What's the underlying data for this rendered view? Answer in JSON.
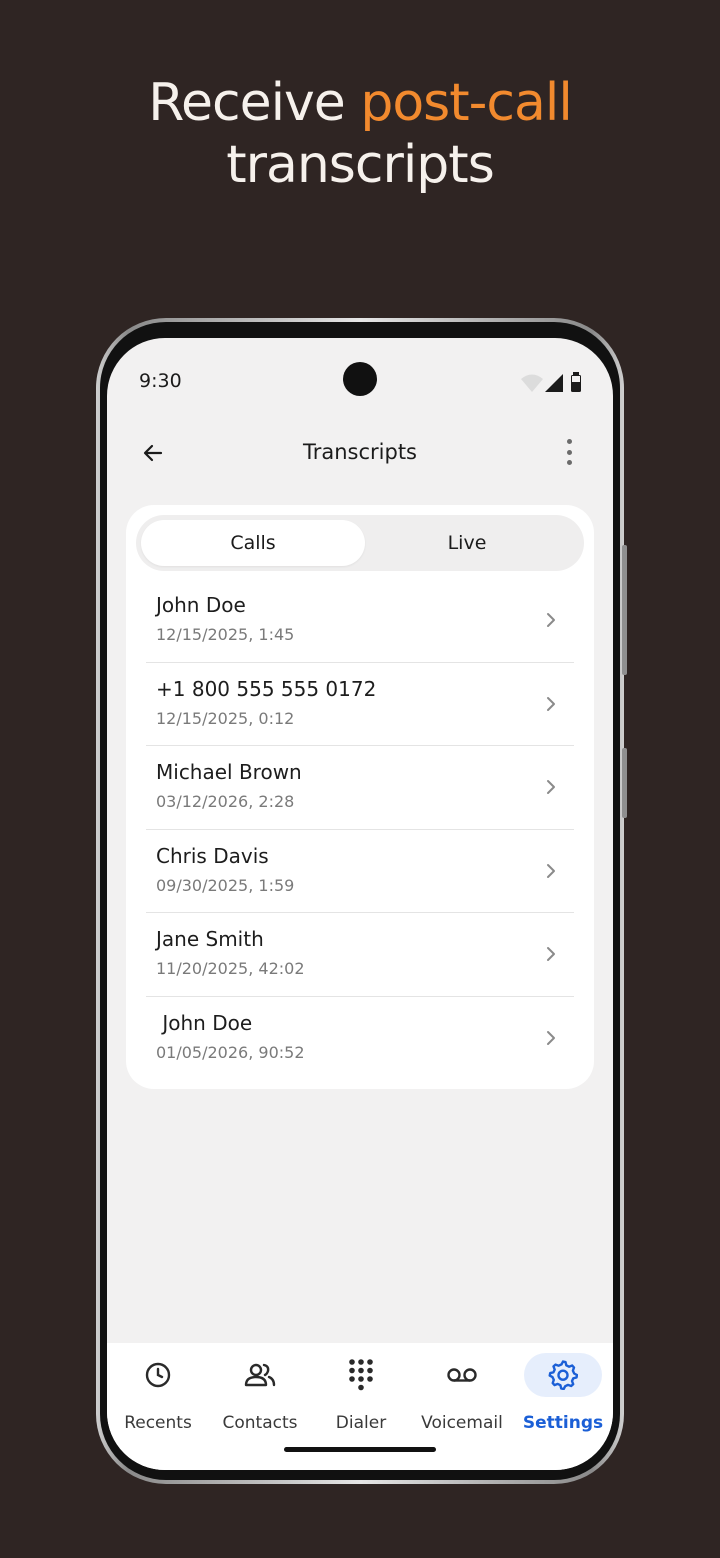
{
  "headline": {
    "part1": "Receive ",
    "accent": "post-call",
    "part2": "transcripts"
  },
  "colors": {
    "background": "#2f2523",
    "accent": "#f28a2e",
    "active_nav": "#1b5fd6"
  },
  "status_bar": {
    "time": "9:30",
    "icons": [
      "wifi-icon",
      "signal-icon",
      "battery-icon"
    ]
  },
  "app_bar": {
    "title": "Transcripts",
    "back_icon": "arrow-left-icon",
    "more_icon": "more-vertical-icon"
  },
  "tabs": {
    "calls": "Calls",
    "live": "Live",
    "selected": "Calls"
  },
  "calls": [
    {
      "name": "John Doe",
      "meta": "12/15/2025, 1:45"
    },
    {
      "name": "+1 800 555 555 0172",
      "meta": "12/15/2025, 0:12"
    },
    {
      "name": "Michael Brown",
      "meta": "03/12/2026, 2:28"
    },
    {
      "name": "Chris Davis",
      "meta": "09/30/2025, 1:59"
    },
    {
      "name": "Jane Smith",
      "meta": "11/20/2025, 42:02"
    },
    {
      "name": " John Doe",
      "meta": "01/05/2026, 90:52"
    }
  ],
  "nav": [
    {
      "label": "Recents",
      "icon": "clock-icon"
    },
    {
      "label": "Contacts",
      "icon": "people-icon"
    },
    {
      "label": "Dialer",
      "icon": "dialpad-icon"
    },
    {
      "label": "Voicemail",
      "icon": "voicemail-icon"
    },
    {
      "label": "Settings",
      "icon": "gear-icon",
      "active": true
    }
  ]
}
